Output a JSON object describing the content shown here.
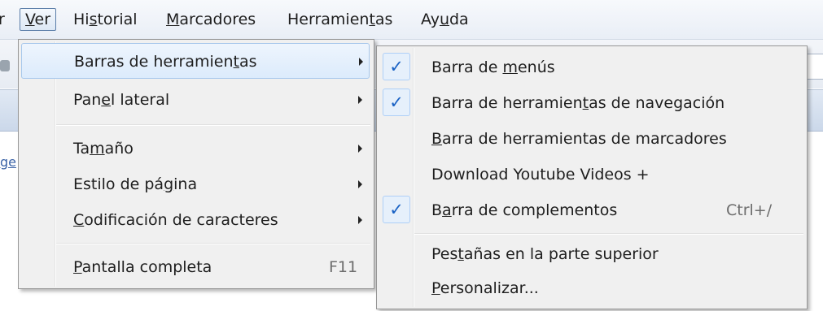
{
  "menubar": {
    "partial_left": "r",
    "items": [
      {
        "pre": "",
        "key": "V",
        "post": "er"
      },
      {
        "pre": "Hi",
        "key": "s",
        "post": "torial"
      },
      {
        "pre": "",
        "key": "M",
        "post": "arcadores"
      },
      {
        "pre": "Herramien",
        "key": "t",
        "post": "as"
      },
      {
        "pre": "Ay",
        "key": "u",
        "post": "da"
      }
    ]
  },
  "background": {
    "link_fragment": "ge"
  },
  "ver_menu": {
    "items": [
      {
        "pre": "Barras de herramien",
        "key": "t",
        "post": "as",
        "has_submenu": true,
        "highlighted": true
      },
      {
        "pre": "Pan",
        "key": "e",
        "post": "l lateral",
        "has_submenu": true
      },
      {
        "pre": "Ta",
        "key": "m",
        "post": "año",
        "has_submenu": true
      },
      {
        "pre": "Estilo de pá",
        "key": "g",
        "post": "ina",
        "has_submenu": true
      },
      {
        "pre": "",
        "key": "C",
        "post": "odificación de caracteres",
        "has_submenu": true
      },
      {
        "pre": "",
        "key": "P",
        "post": "antalla completa",
        "accelerator": "F11"
      }
    ]
  },
  "toolbars_submenu": {
    "check_glyph": "✓",
    "items": [
      {
        "pre": "Barra de ",
        "key": "m",
        "post": "enús",
        "checked": true
      },
      {
        "pre": "Barra de herramien",
        "key": "t",
        "post": "as de navegación",
        "checked": true
      },
      {
        "pre": "",
        "key": "B",
        "post": "arra de herramientas de marcadores",
        "checked": false
      },
      {
        "pre": "Download Youtube Videos +",
        "key": "",
        "post": "",
        "checked": false
      },
      {
        "pre": "B",
        "key": "a",
        "post": "rra de complementos",
        "checked": true,
        "accelerator": "Ctrl+/"
      },
      {
        "pre": "Pes",
        "key": "t",
        "post": "añas en la parte superior",
        "checked": false
      },
      {
        "pre": "",
        "key": "P",
        "post": "ersonalizar...",
        "checked": false
      }
    ]
  }
}
